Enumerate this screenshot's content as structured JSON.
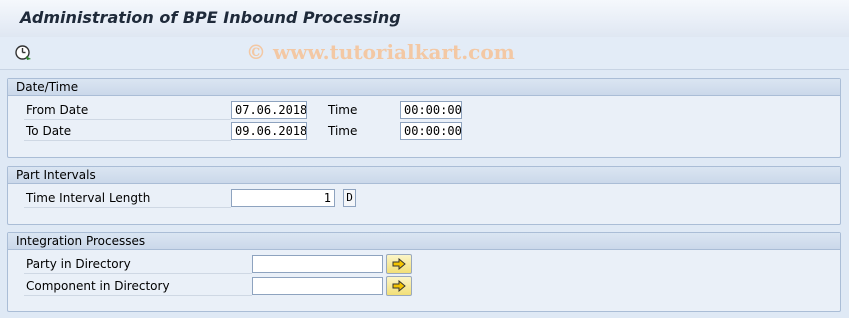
{
  "window": {
    "title": "Administration of BPE Inbound Processing"
  },
  "toolbar": {
    "execute_icon": "execute-clock-icon"
  },
  "watermark": "© www.tutorialkart.com",
  "groups": {
    "datetime": {
      "title": "Date/Time",
      "from_date_label": "From Date",
      "from_date_value": "07.06.2018",
      "from_time_label": "Time",
      "from_time_value": "00:00:00",
      "to_date_label": "To Date",
      "to_date_value": "09.06.2018",
      "to_time_label": "Time",
      "to_time_value": "00:00:00"
    },
    "part_intervals": {
      "title": "Part Intervals",
      "interval_label": "Time Interval Length",
      "interval_value": "1",
      "interval_unit": "D"
    },
    "integration": {
      "title": "Integration Processes",
      "party_label": "Party in Directory",
      "party_value": "",
      "component_label": "Component in Directory",
      "component_value": "",
      "button_icon": "arrow-right-icon"
    }
  },
  "colors": {
    "background": "#dfe9f5",
    "group_header": "#cbd8ea",
    "f4_button": "#f2df77"
  }
}
